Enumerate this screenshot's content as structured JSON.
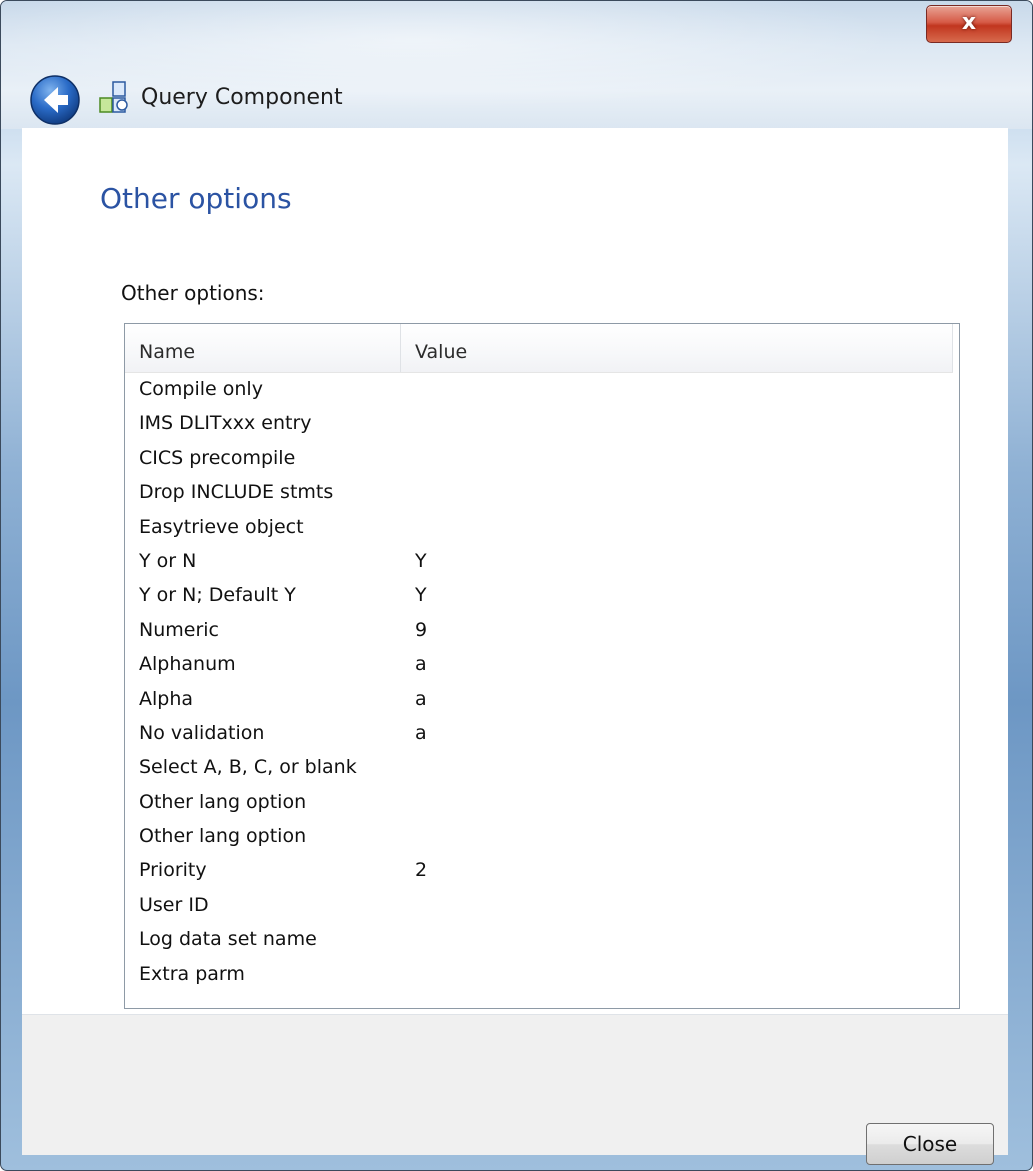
{
  "window": {
    "title": "Query Component",
    "close_glyph": "x"
  },
  "page": {
    "heading": "Other options",
    "section_label": "Other options:"
  },
  "list": {
    "columns": {
      "name": "Name",
      "value": "Value"
    },
    "rows": [
      {
        "name": "Compile only",
        "value": ""
      },
      {
        "name": "IMS DLITxxx entry",
        "value": ""
      },
      {
        "name": "CICS precompile",
        "value": ""
      },
      {
        "name": "Drop INCLUDE stmts",
        "value": ""
      },
      {
        "name": "Easytrieve object",
        "value": ""
      },
      {
        "name": "Y or N",
        "value": "Y"
      },
      {
        "name": "Y or N; Default Y",
        "value": "Y"
      },
      {
        "name": "Numeric",
        "value": "9"
      },
      {
        "name": "Alphanum",
        "value": "a"
      },
      {
        "name": "Alpha",
        "value": "a"
      },
      {
        "name": "No validation",
        "value": "a"
      },
      {
        "name": "Select A, B, C, or blank",
        "value": ""
      },
      {
        "name": "Other lang option",
        "value": ""
      },
      {
        "name": "Other lang option",
        "value": ""
      },
      {
        "name": "Priority",
        "value": "2"
      },
      {
        "name": "User ID",
        "value": ""
      },
      {
        "name": "Log data set name",
        "value": ""
      },
      {
        "name": "Extra parm",
        "value": ""
      }
    ]
  },
  "footer": {
    "close_label": "Close"
  },
  "icons": {
    "back": "back-arrow-icon",
    "app": "query-component-icon",
    "close": "close-icon"
  },
  "colors": {
    "heading": "#2b53a3",
    "close_x_bg": "#c1361f",
    "back_button": "#1f5fb6"
  }
}
